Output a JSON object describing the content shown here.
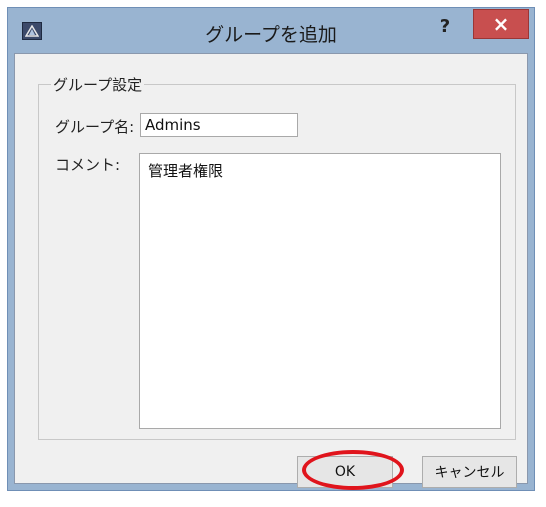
{
  "window": {
    "title": "グループを追加",
    "help_glyph": "?",
    "close_glyph": "×"
  },
  "group": {
    "legend": "グループ設定",
    "name_label": "グループ名:",
    "name_value": "Admins",
    "comment_label": "コメント:",
    "comment_value": "管理者権限"
  },
  "buttons": {
    "ok_label": "OK",
    "cancel_label": "キャンセル"
  },
  "colors": {
    "title_bar": "#99b4d1",
    "close_button": "#c84f4f",
    "highlight_ring": "#e0141c"
  },
  "icons": {
    "app": "app-icon",
    "close": "close-icon",
    "help": "help-icon"
  }
}
